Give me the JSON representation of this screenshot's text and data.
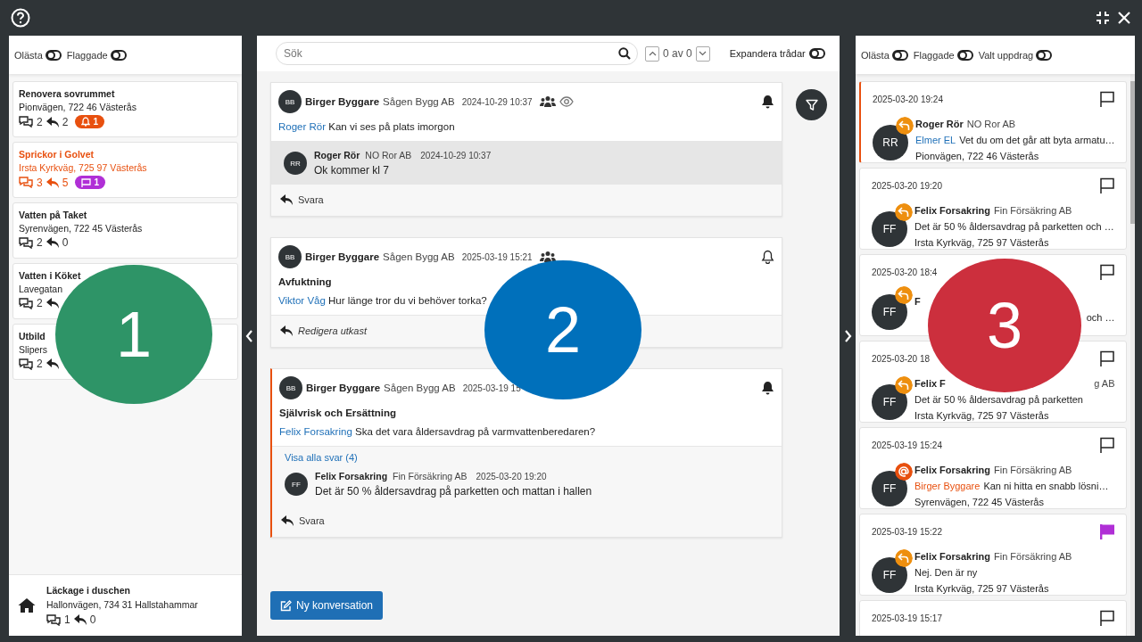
{
  "left": {
    "filters": [
      {
        "label": "Olästa",
        "on": false
      },
      {
        "label": "Flaggade",
        "on": false
      }
    ],
    "items": [
      {
        "title": "Renovera sovrummet",
        "address": "Pionvägen, 722 46 Västerås",
        "comments": "2",
        "replies": "2",
        "highlighted": false,
        "badge": {
          "kind": "bell",
          "count": "1",
          "color": "#e8500f"
        }
      },
      {
        "title": "Sprickor i Golvet",
        "address": "Irsta Kyrkväg, 725 97 Västerås",
        "comments": "3",
        "replies": "5",
        "highlighted": true,
        "badge": {
          "kind": "flag",
          "count": "1",
          "color": "#b02fd6"
        }
      },
      {
        "title": "Vatten på Taket",
        "address": "Syrenvägen, 722 45 Västerås",
        "comments": "2",
        "replies": "0",
        "highlighted": false
      },
      {
        "title": "Vatten i Köket",
        "address": "Lavegatan",
        "comments": "2",
        "highlighted": false
      },
      {
        "title": "Utbild",
        "address": "Slipers",
        "comments": "2",
        "highlighted": false
      }
    ],
    "footer": {
      "title": "Läckage i duschen",
      "address": "Hallonvägen, 734 31 Hallstahammar",
      "comments": "1",
      "replies": "0"
    }
  },
  "center": {
    "search": {
      "placeholder": "Sök"
    },
    "match_count": "0 av 0",
    "expand": {
      "label": "Expandera trådar",
      "on": false
    },
    "threads": [
      {
        "initials": "BB",
        "author": "Birger Byggare",
        "org": "Sågen Bygg AB",
        "time": "2024-10-29 10:37",
        "participants": true,
        "seen": true,
        "notify": true,
        "accent": false,
        "mention": "Roger Rör",
        "text": "Kan vi ses på plats imorgon",
        "replies": [
          {
            "initials": "RR",
            "author": "Roger Rör",
            "org": "NO Ror AB",
            "time": "2024-10-29 10:37",
            "text": "Ok kommer kl 7",
            "highlighted": true
          }
        ],
        "action": {
          "label": "Svara",
          "draft": false
        }
      },
      {
        "initials": "BB",
        "author": "Birger Byggare",
        "org": "Sågen Bygg AB",
        "time": "2025-03-19 15:21",
        "participants": true,
        "seen": false,
        "notify": false,
        "accent": false,
        "subject": "Avfuktning",
        "mention": "Viktor Våg",
        "text": "Hur länge tror du vi behöver torka?",
        "action": {
          "label": "Redigera utkast",
          "draft": true
        }
      },
      {
        "initials": "BB",
        "author": "Birger Byggare",
        "org": "Sågen Bygg AB",
        "time": "2025-03-19 15",
        "participants": false,
        "seen": false,
        "notify": true,
        "accent": true,
        "subject": "Självrisk och Ersättning",
        "mention": "Felix Forsakring",
        "text": "Ska det vara åldersavdrag på varmvattenberedaren?",
        "show_all": "Visa alla svar (4)",
        "replies": [
          {
            "initials": "FF",
            "author": "Felix Forsakring",
            "org": "Fin Försäkring AB",
            "time": "2025-03-20 19:20",
            "text": "Det är 50 % åldersavdrag på parketten och mattan i hallen",
            "highlighted": false
          }
        ],
        "action": {
          "label": "Svara",
          "draft": false
        }
      }
    ],
    "new_button": "Ny konversation"
  },
  "right": {
    "filters": [
      {
        "label": "Olästa",
        "on": false
      },
      {
        "label": "Flaggade",
        "on": false
      },
      {
        "label": "Valt uppdrag",
        "on": false
      }
    ],
    "items": [
      {
        "time": "2025-03-20 19:24",
        "flagged": false,
        "accent": true,
        "initials": "RR",
        "kind": "reply",
        "author": "Roger Rör",
        "org": "NO Ror AB",
        "mention": "Elmer EL",
        "mention_self": false,
        "text": "Vet du om det går att byta armatu…",
        "address": "Pionvägen, 722 46 Västerås"
      },
      {
        "time": "2025-03-20 19:20",
        "flagged": false,
        "accent": false,
        "initials": "FF",
        "kind": "reply",
        "author": "Felix Forsakring",
        "org": "Fin Försäkring AB",
        "text": "Det är 50 % åldersavdrag på parketten och …",
        "address": "Irsta Kyrkväg, 725 97 Västerås"
      },
      {
        "time": "2025-03-20 18:4",
        "flagged": false,
        "accent": false,
        "initials": "FF",
        "kind": "reply",
        "author": "F",
        "text_tail": "och …"
      },
      {
        "time": "2025-03-20 18",
        "flagged": false,
        "accent": false,
        "initials": "FF",
        "kind": "reply",
        "author": "Felix F",
        "org_tail": "g AB",
        "text": "Det är 50 % åldersavdrag på parketten",
        "address": "Irsta Kyrkväg, 725 97 Västerås"
      },
      {
        "time": "2025-03-19 15:24",
        "flagged": false,
        "accent": false,
        "initials": "FF",
        "kind": "mention",
        "author": "Felix Forsakring",
        "org": "Fin Försäkring AB",
        "mention": "Birger Byggare",
        "mention_self": true,
        "text": "Kan ni hitta en snabb lösni…",
        "address": "Syrenvägen, 722 45 Västerås"
      },
      {
        "time": "2025-03-19 15:22",
        "flagged": true,
        "accent": false,
        "initials": "FF",
        "kind": "reply",
        "author": "Felix Forsakring",
        "org": "Fin Försäkring AB",
        "text": "Nej. Den är ny",
        "address": "Irsta Kyrkväg, 725 97 Västerås"
      },
      {
        "time": "2025-03-19 15:17",
        "flagged": false,
        "accent": false
      }
    ]
  },
  "callouts": [
    {
      "label": "1",
      "color": "#2e9467"
    },
    {
      "label": "2",
      "color": "#0070bb"
    },
    {
      "label": "3",
      "color": "#cc2f3d"
    }
  ]
}
